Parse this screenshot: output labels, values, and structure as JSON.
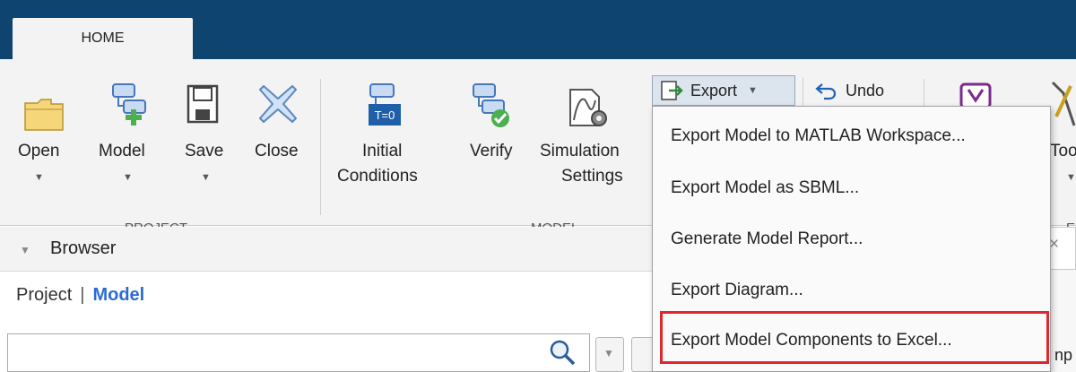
{
  "tabs": {
    "home": "HOME"
  },
  "ribbon": {
    "project_group_label": "PROJECT",
    "model_group_label": "MODEL",
    "right_group_label_partial": "E",
    "tools": {
      "open": "Open",
      "model": "Model",
      "save": "Save",
      "close": "Close",
      "initial_conditions_line1": "Initial",
      "initial_conditions_line2": "Conditions",
      "verify": "Verify",
      "simulation_settings_line1": "Simulation",
      "simulation_settings_line2": "Settings",
      "tools_partial": "Too",
      "tn_badge": "T=0"
    },
    "export_button": "Export",
    "undo_button": "Undo"
  },
  "export_menu": {
    "items": [
      "Export Model to MATLAB Workspace...",
      "Export Model as SBML...",
      "Generate Model Report...",
      "Export Diagram...",
      "Export Model Components to Excel..."
    ]
  },
  "browser": {
    "title": "Browser",
    "nav_project": "Project",
    "nav_separator": "|",
    "nav_model": "Model",
    "search_value": "",
    "right_peek_text": "np"
  },
  "colors": {
    "title_bar": "#0e4470",
    "ribbon_bg": "#f3f3f3",
    "link_blue": "#2c6bd2",
    "highlight_red": "#e3262d"
  },
  "icons": [
    "folder-icon",
    "model-add-icon",
    "save-disk-icon",
    "close-x-icon",
    "initial-conditions-icon",
    "verify-check-icon",
    "simulation-settings-icon",
    "export-icon",
    "undo-icon",
    "report-icon",
    "tools-icon",
    "search-icon",
    "filter-icon"
  ]
}
